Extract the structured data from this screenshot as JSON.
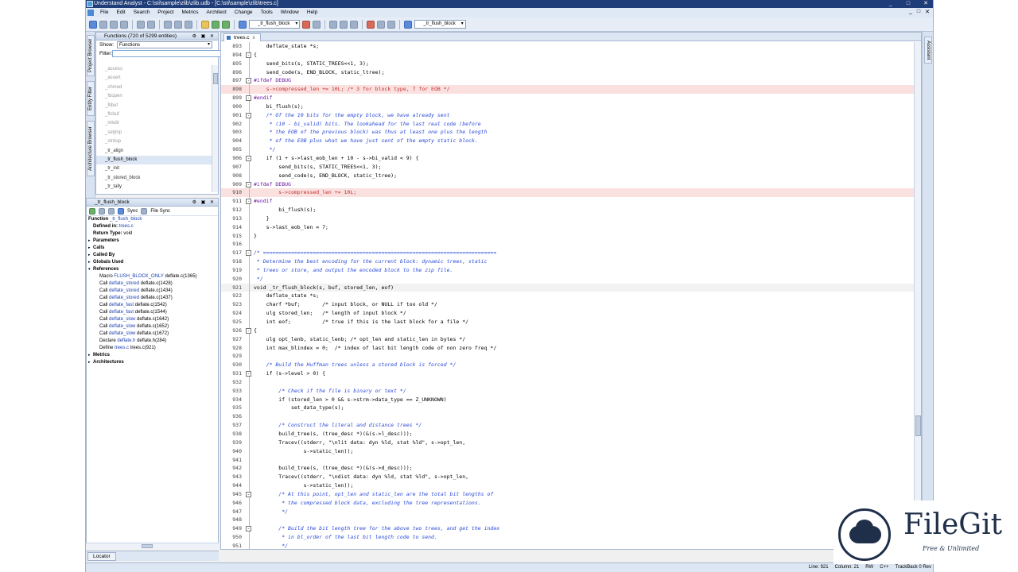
{
  "window": {
    "title": "Understand Analyst - C:\\sti\\sample\\zlib\\zlib.udb - [C:\\sti\\sample\\zlib\\trees.c]",
    "controls": [
      "_",
      "□",
      "✕"
    ]
  },
  "menu": [
    "File",
    "Edit",
    "Search",
    "Project",
    "Metrics",
    "Architect",
    "Change",
    "Tools",
    "Window",
    "Help"
  ],
  "toolbar": {
    "combo1": "_tr_flush_block",
    "combo2": "_tr_flush_block"
  },
  "side_tabs": [
    "Project Browser",
    "Entity Filter",
    "Architecture Browser"
  ],
  "right_tab": "Assistant",
  "functions_panel": {
    "title": "Functions (720 of 5299 entities)",
    "show_label": "Show:",
    "show_value": "Functions",
    "filter_label": "Filter:",
    "entities": [
      "_access",
      "_assert",
      "_chmod",
      "_fdopen",
      "_filbuf",
      "_flsbuf",
      "_mkdir",
      "_setjmp",
      "_strdup",
      "_tr_align",
      "_tr_flush_block",
      "_tr_init",
      "_tr_stored_block",
      "_tr_tally"
    ],
    "selected": "_tr_flush_block"
  },
  "info_panel": {
    "title": "_tr_flush_block",
    "sync": "Sync",
    "file_sync": "File Sync",
    "header_kind": "Function",
    "header_name": "_tr_flush_block",
    "defined_in_label": "Defined in:",
    "defined_in": "trees.c",
    "return_label": "Return Type:",
    "return_type": "void",
    "sections": [
      "Parameters",
      "Calls",
      "Called By",
      "Globals Used"
    ],
    "references_label": "References",
    "references": [
      {
        "kind": "Macro",
        "name": "FLUSH_BLOCK_ONLY",
        "loc": "deflate.c(1365)"
      },
      {
        "kind": "Call",
        "name": "deflate_stored",
        "loc": "deflate.c(1428)"
      },
      {
        "kind": "Call",
        "name": "deflate_stored",
        "loc": "deflate.c(1434)"
      },
      {
        "kind": "Call",
        "name": "deflate_stored",
        "loc": "deflate.c(1437)"
      },
      {
        "kind": "Call",
        "name": "deflate_fast",
        "loc": "deflate.c(1542)"
      },
      {
        "kind": "Call",
        "name": "deflate_fast",
        "loc": "deflate.c(1544)"
      },
      {
        "kind": "Call",
        "name": "deflate_slow",
        "loc": "deflate.c(1642)"
      },
      {
        "kind": "Call",
        "name": "deflate_slow",
        "loc": "deflate.c(1652)"
      },
      {
        "kind": "Call",
        "name": "deflate_slow",
        "loc": "deflate.c(1672)"
      },
      {
        "kind": "Declare",
        "name": "deflate.h",
        "loc": "deflate.h(284)"
      },
      {
        "kind": "Define",
        "name": "trees.c",
        "loc": "trees.c(921)"
      }
    ],
    "tail_sections": [
      "Metrics",
      "Architectures"
    ]
  },
  "locator_tab": "Locator",
  "editor": {
    "tab": "trees.c",
    "lines": [
      {
        "n": "893",
        "t": "    deflate_state *s;",
        "k": "code"
      },
      {
        "n": "894",
        "t": "{",
        "k": "code",
        "f": "-"
      },
      {
        "n": "895",
        "t": "    send_bits(s, STATIC_TREES<<1, 3);",
        "k": "code"
      },
      {
        "n": "896",
        "t": "    send_code(s, END_BLOCK, static_ltree);",
        "k": "code"
      },
      {
        "n": "897",
        "t": "#ifdef DEBUG",
        "k": "pp",
        "f": "-"
      },
      {
        "n": "898",
        "t": "    s->compressed_len += 10L; /* 3 for block type, 7 for EOB */",
        "k": "hl"
      },
      {
        "n": "899",
        "t": "#endif",
        "k": "pp",
        "f": "-"
      },
      {
        "n": "900",
        "t": "    bi_flush(s);",
        "k": "code"
      },
      {
        "n": "901",
        "t": "    /* Of the 10 bits for the empty block, we have already sent",
        "k": "cmt",
        "f": "-"
      },
      {
        "n": "902",
        "t": "     * (10 - bi_valid) bits. The lookahead for the last real code (before",
        "k": "cmt"
      },
      {
        "n": "903",
        "t": "     * the EOB of the previous block) was thus at least one plus the length",
        "k": "cmt"
      },
      {
        "n": "904",
        "t": "     * of the EOB plus what we have just sent of the empty static block.",
        "k": "cmt"
      },
      {
        "n": "905",
        "t": "     */",
        "k": "cmt"
      },
      {
        "n": "906",
        "t": "    if (1 + s->last_eob_len + 10 - s->bi_valid < 9) {",
        "k": "code",
        "f": "-"
      },
      {
        "n": "907",
        "t": "        send_bits(s, STATIC_TREES<<1, 3);",
        "k": "code"
      },
      {
        "n": "908",
        "t": "        send_code(s, END_BLOCK, static_ltree);",
        "k": "code"
      },
      {
        "n": "909",
        "t": "#ifdef DEBUG",
        "k": "pp",
        "f": "-"
      },
      {
        "n": "910",
        "t": "        s->compressed_len += 10L;",
        "k": "hl"
      },
      {
        "n": "911",
        "t": "#endif",
        "k": "pp",
        "f": "-"
      },
      {
        "n": "912",
        "t": "        bi_flush(s);",
        "k": "code"
      },
      {
        "n": "913",
        "t": "    }",
        "k": "code"
      },
      {
        "n": "914",
        "t": "    s->last_eob_len = 7;",
        "k": "code"
      },
      {
        "n": "915",
        "t": "}",
        "k": "code"
      },
      {
        "n": "916",
        "t": "",
        "k": "code"
      },
      {
        "n": "917",
        "t": "/* ===========================================================================",
        "k": "cmt",
        "f": "-"
      },
      {
        "n": "918",
        "t": " * Determine the best encoding for the current block: dynamic trees, static",
        "k": "cmt"
      },
      {
        "n": "919",
        "t": " * trees or store, and output the encoded block to the zip file.",
        "k": "cmt"
      },
      {
        "n": "920",
        "t": " */",
        "k": "cmt"
      },
      {
        "n": "921",
        "t": "void _tr_flush_block(s, buf, stored_len, eof)",
        "k": "cur"
      },
      {
        "n": "922",
        "t": "    deflate_state *s;",
        "k": "code"
      },
      {
        "n": "923",
        "t": "    charf *buf;       /* input block, or NULL if too old */",
        "k": "code"
      },
      {
        "n": "924",
        "t": "    ulg stored_len;   /* length of input block */",
        "k": "code"
      },
      {
        "n": "925",
        "t": "    int eof;          /* true if this is the last block for a file */",
        "k": "code"
      },
      {
        "n": "926",
        "t": "{",
        "k": "code",
        "f": "-"
      },
      {
        "n": "927",
        "t": "    ulg opt_lenb, static_lenb; /* opt_len and static_len in bytes */",
        "k": "code"
      },
      {
        "n": "928",
        "t": "    int max_blindex = 0;  /* index of last bit length code of non zero freq */",
        "k": "code"
      },
      {
        "n": "929",
        "t": "",
        "k": "code"
      },
      {
        "n": "930",
        "t": "    /* Build the Huffman trees unless a stored block is forced */",
        "k": "cmt"
      },
      {
        "n": "931",
        "t": "    if (s->level > 0) {",
        "k": "code",
        "f": "-"
      },
      {
        "n": "932",
        "t": "",
        "k": "code"
      },
      {
        "n": "933",
        "t": "        /* Check if the file is binary or text */",
        "k": "cmt"
      },
      {
        "n": "934",
        "t": "        if (stored_len > 0 && s->strm->data_type == Z_UNKNOWN)",
        "k": "code"
      },
      {
        "n": "935",
        "t": "            set_data_type(s);",
        "k": "code"
      },
      {
        "n": "936",
        "t": "",
        "k": "code"
      },
      {
        "n": "937",
        "t": "        /* Construct the literal and distance trees */",
        "k": "cmt"
      },
      {
        "n": "938",
        "t": "        build_tree(s, (tree_desc *)(&(s->l_desc)));",
        "k": "code"
      },
      {
        "n": "939",
        "t": "        Tracev((stderr, \"\\nlit data: dyn %ld, stat %ld\", s->opt_len,",
        "k": "code"
      },
      {
        "n": "940",
        "t": "                s->static_len));",
        "k": "code"
      },
      {
        "n": "941",
        "t": "",
        "k": "code"
      },
      {
        "n": "942",
        "t": "        build_tree(s, (tree_desc *)(&(s->d_desc)));",
        "k": "code"
      },
      {
        "n": "943",
        "t": "        Tracev((stderr, \"\\ndist data: dyn %ld, stat %ld\", s->opt_len,",
        "k": "code"
      },
      {
        "n": "944",
        "t": "                s->static_len));",
        "k": "code"
      },
      {
        "n": "945",
        "t": "        /* At this point, opt_len and static_len are the total bit lengths of",
        "k": "cmt",
        "f": "-"
      },
      {
        "n": "946",
        "t": "         * the compressed block data, excluding the tree representations.",
        "k": "cmt"
      },
      {
        "n": "947",
        "t": "         */",
        "k": "cmt"
      },
      {
        "n": "948",
        "t": "",
        "k": "code"
      },
      {
        "n": "949",
        "t": "        /* Build the bit length tree for the above two trees, and get the index",
        "k": "cmt",
        "f": "-"
      },
      {
        "n": "950",
        "t": "         * in bl_order of the last bit length code to send.",
        "k": "cmt"
      },
      {
        "n": "951",
        "t": "         */",
        "k": "cmt"
      }
    ]
  },
  "status": {
    "line": "Line: 921",
    "column": "Column: 21",
    "mode": "RW",
    "lang": "C++",
    "track": "TrackBack 0 Rev"
  },
  "watermark": {
    "brand": "FileGit",
    "tagline": "Free & Unlimited"
  }
}
